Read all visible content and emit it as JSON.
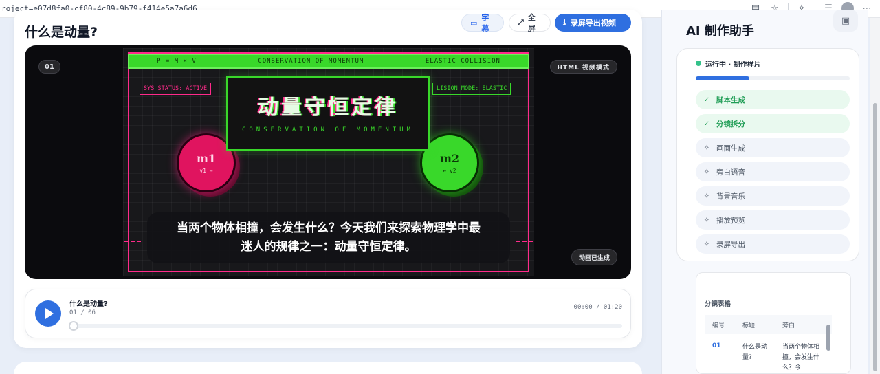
{
  "browser": {
    "url": "roject=e07d8fa0-cf80-4c89-9b79-f414e5a7a6d6"
  },
  "main": {
    "title": "什么是动量?",
    "buttons": {
      "subtitle": "字幕",
      "fullscreen": "全屏",
      "export": "录屏导出视频"
    }
  },
  "video": {
    "index_badge": "01",
    "mode_badge": "HTML 视频模式",
    "status_badge": "动画已生成",
    "scene": {
      "top_left": "P = M × V",
      "top_center": "CONSERVATION OF MOMENTUM",
      "top_right": "ELASTIC COLLISION",
      "sys_status": "SYS_STATUS: ACTIVE",
      "collision_mode": "LISION_MODE: ELASTIC",
      "heading": "动量守恒定律",
      "heading_en": "CONSERVATION OF MOMENTUM",
      "ball1_label": "m1",
      "ball1_vel": "v1 →",
      "ball2_label": "m2",
      "ball2_vel": "← v2"
    },
    "subtitle_line1": "当两个物体相撞，会发生什么？今天我们来探索物理学中最",
    "subtitle_line2": "迷人的规律之一：动量守恒定律。"
  },
  "player": {
    "title": "什么是动量?",
    "count": "01 / 06",
    "time": "00:00 / 01:20",
    "progress": 0
  },
  "assistant": {
    "title": "AI 制作助手",
    "status": "运行中 · 制作样片",
    "progress": 0.35,
    "steps": [
      {
        "label": "脚本生成",
        "state": "done"
      },
      {
        "label": "分镜拆分",
        "state": "done"
      },
      {
        "label": "画面生成",
        "state": "pending"
      },
      {
        "label": "旁白语音",
        "state": "pending"
      },
      {
        "label": "背景音乐",
        "state": "pending"
      },
      {
        "label": "播放预览",
        "state": "pending"
      },
      {
        "label": "录屏导出",
        "state": "pending"
      }
    ],
    "table": {
      "label": "分镜表格",
      "headers": [
        "编号",
        "标题",
        "旁白"
      ],
      "rows": [
        {
          "num": "01",
          "title": "什么是动量?",
          "narration": "当两个物体相撞，会发生什么？今"
        }
      ]
    }
  },
  "colors": {
    "accent": "#2f6fe0",
    "neon_pink": "#ff2a8a",
    "neon_green": "#39d82a",
    "done_green": "#1f9d55"
  }
}
